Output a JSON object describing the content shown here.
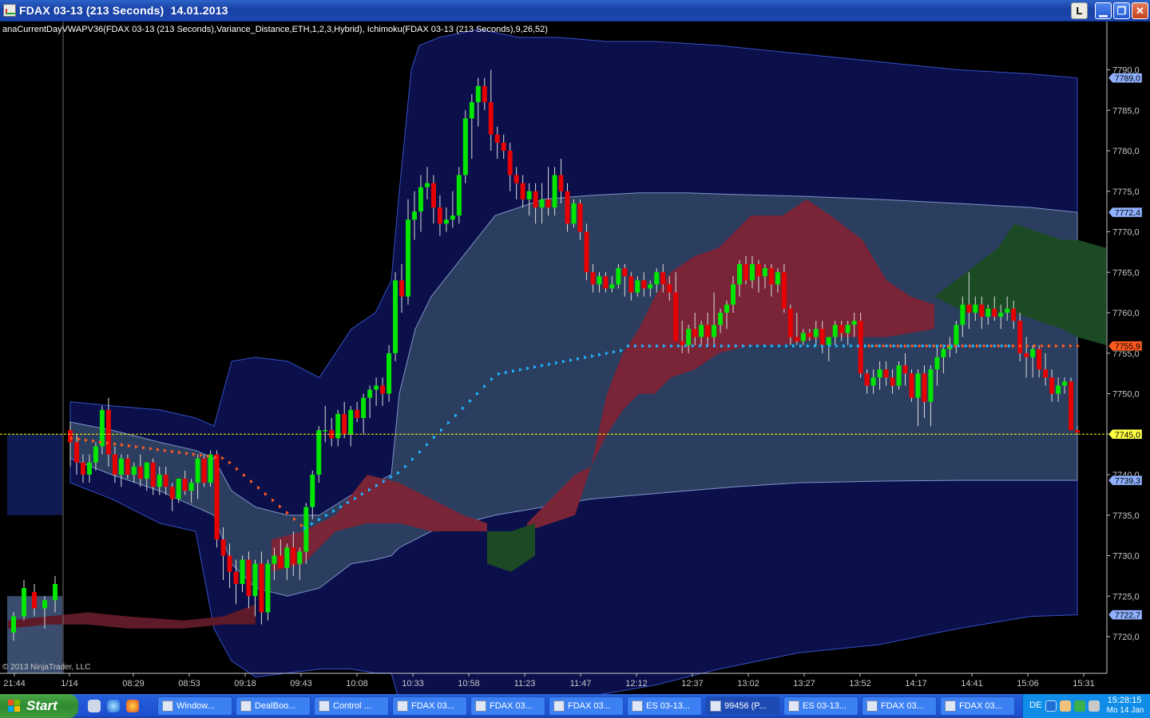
{
  "window": {
    "title": "FDAX 03-13 (213 Seconds)  14.01.2013",
    "btn_l": "L"
  },
  "chart": {
    "indicator_label": "anaCurrentDayVWAPV36(FDAX 03-13 (213 Seconds),Variance_Distance,ETH,1,2,3,Hybrid),  Ichimoku(FDAX 03-13 (213 Seconds),9,26,52)",
    "copyright": "© 2013 NinjaTrader, LLC",
    "colors": {
      "up": "#00e600",
      "down": "#e60000",
      "vwap_band": "#2c3e5f",
      "outer_band": "#0b0f4a",
      "kumo_red": "#7a2438",
      "kumo_green": "#1b4a25",
      "tenkan": "#ff5a1e",
      "kijun": "#1eb4ff",
      "current_line": "#ffff00"
    }
  },
  "chart_data": {
    "type": "candlestick",
    "title": "FDAX 03-13 (213 Seconds)",
    "ylim": [
      7715,
      7795
    ],
    "y_ticks": [
      "7720,0",
      "7725,0",
      "7730,0",
      "7735,0",
      "7740,0",
      "7745,0",
      "7750,0",
      "7755,0",
      "7760,0",
      "7765,0",
      "7770,0",
      "7775,0",
      "7780,0",
      "7785,0",
      "7790,0"
    ],
    "x_ticks": [
      "21:44",
      "1/14",
      "08:29",
      "08:53",
      "09:18",
      "09:43",
      "10:08",
      "10:33",
      "10:58",
      "11:23",
      "11:47",
      "12:12",
      "12:37",
      "13:02",
      "13:27",
      "13:52",
      "14:17",
      "14:41",
      "15:06",
      "15:31"
    ],
    "price_markers": [
      {
        "label": "7789,0",
        "value": 7789.0,
        "color": "#8fb1ff"
      },
      {
        "label": "7772,4",
        "value": 7772.4,
        "color": "#8fb1ff"
      },
      {
        "label": "7755,9",
        "value": 7755.9,
        "color": "#ff5a1e"
      },
      {
        "label": "7745,0",
        "value": 7745.0,
        "color": "#ffff44"
      },
      {
        "label": "7739,3",
        "value": 7739.3,
        "color": "#8fb1ff"
      },
      {
        "label": "7722,7",
        "value": 7722.7,
        "color": "#8fb1ff"
      }
    ],
    "current_price": 7745.0,
    "candles": [
      [
        7720.5,
        7723,
        7719.5,
        7722.5
      ],
      [
        7722.5,
        7727,
        7722,
        7726
      ],
      [
        7725.5,
        7726.5,
        7722.5,
        7723.5
      ],
      [
        7723.5,
        7725,
        7721,
        7724.5
      ],
      [
        7724.5,
        7727.5,
        7723,
        7726.5
      ],
      [
        7745.5,
        7746.5,
        7741,
        7744
      ],
      [
        7744,
        7745,
        7740,
        7741.5
      ],
      [
        7741.5,
        7742.5,
        7739,
        7740
      ],
      [
        7740,
        7742.5,
        7739,
        7741.5
      ],
      [
        7741.5,
        7744,
        7740.5,
        7743.5
      ],
      [
        7743.5,
        7748.5,
        7742.5,
        7748
      ],
      [
        7748,
        7749.5,
        7741,
        7742.5
      ],
      [
        7742.5,
        7743.5,
        7739,
        7740
      ],
      [
        7740,
        7742.5,
        7738.5,
        7742
      ],
      [
        7742,
        7742.5,
        7739.5,
        7740
      ],
      [
        7740,
        7741.5,
        7739,
        7741
      ],
      [
        7741,
        7742.5,
        7738.5,
        7739.5
      ],
      [
        7739.5,
        7741.5,
        7738,
        7741.5
      ],
      [
        7741.5,
        7742,
        7737.5,
        7738.5
      ],
      [
        7738.5,
        7741,
        7737.5,
        7740
      ],
      [
        7740,
        7741,
        7737.5,
        7738.5
      ],
      [
        7738.5,
        7739,
        7735.5,
        7737
      ],
      [
        7737,
        7739.5,
        7736.5,
        7739.5
      ],
      [
        7739.5,
        7740.5,
        7737.5,
        7738
      ],
      [
        7738,
        7739.5,
        7736.5,
        7739
      ],
      [
        7739,
        7742.5,
        7737,
        7742
      ],
      [
        7742,
        7742.5,
        7738.5,
        7739
      ],
      [
        7739,
        7743,
        7738.5,
        7742.5
      ],
      [
        7742.5,
        7743,
        7731,
        7732
      ],
      [
        7732,
        7733.5,
        7727,
        7730
      ],
      [
        7730,
        7731.5,
        7726,
        7728
      ],
      [
        7728,
        7729.5,
        7724,
        7726.5
      ],
      [
        7726.5,
        7730,
        7725.5,
        7729.5
      ],
      [
        7729.5,
        7730.5,
        7723.5,
        7725
      ],
      [
        7725,
        7729.5,
        7722.5,
        7729
      ],
      [
        7729,
        7730.5,
        7721.5,
        7723
      ],
      [
        7723,
        7729.5,
        7722,
        7729
      ],
      [
        7729,
        7731,
        7727,
        7730
      ],
      [
        7730,
        7732,
        7728.5,
        7728.5
      ],
      [
        7728.5,
        7731.5,
        7727,
        7731
      ],
      [
        7731,
        7733,
        7727.5,
        7729
      ],
      [
        7729,
        7731,
        7727,
        7730.5
      ],
      [
        7730.5,
        7736.5,
        7729,
        7736
      ],
      [
        7736,
        7740.5,
        7734.5,
        7740
      ],
      [
        7740,
        7746,
        7739,
        7745.5
      ],
      [
        7745.5,
        7748.5,
        7744,
        7745.5
      ],
      [
        7745.5,
        7747,
        7743.5,
        7744.5
      ],
      [
        7744.5,
        7748,
        7743.5,
        7747.5
      ],
      [
        7747.5,
        7749,
        7744.5,
        7745
      ],
      [
        7745,
        7748.5,
        7743.5,
        7748
      ],
      [
        7748,
        7749,
        7746.5,
        7747
      ],
      [
        7747,
        7750,
        7745,
        7749.5
      ],
      [
        7749.5,
        7751,
        7747,
        7750.5
      ],
      [
        7750.5,
        7752,
        7748.5,
        7751
      ],
      [
        7751,
        7752,
        7748.5,
        7750
      ],
      [
        7750,
        7756,
        7749,
        7755
      ],
      [
        7755,
        7765,
        7754,
        7764
      ],
      [
        7764,
        7766,
        7760,
        7762
      ],
      [
        7762,
        7774,
        7761,
        7771.5
      ],
      [
        7771.5,
        7775,
        7769,
        7772.5
      ],
      [
        7772.5,
        7777,
        7770,
        7775.5
      ],
      [
        7775.5,
        7778,
        7774,
        7776
      ],
      [
        7776,
        7777,
        7771,
        7773
      ],
      [
        7773,
        7774.5,
        7769.5,
        7771
      ],
      [
        7771,
        7773,
        7770,
        7771.5
      ],
      [
        7771.5,
        7775,
        7770.5,
        7772
      ],
      [
        7772,
        7778,
        7771,
        7777
      ],
      [
        7777,
        7785,
        7776,
        7784
      ],
      [
        7784,
        7787,
        7779,
        7786
      ],
      [
        7786,
        7789,
        7783,
        7788
      ],
      [
        7788,
        7789,
        7785,
        7786
      ],
      [
        7786,
        7790,
        7780,
        7782
      ],
      [
        7782,
        7783,
        7779,
        7781
      ],
      [
        7781,
        7782,
        7779,
        7780
      ],
      [
        7780,
        7781,
        7775,
        7777
      ],
      [
        7777,
        7778,
        7774,
        7776
      ],
      [
        7776,
        7777,
        7773,
        7774
      ],
      [
        7774,
        7776,
        7772,
        7775
      ],
      [
        7775,
        7776,
        7771,
        7773
      ],
      [
        7773,
        7776,
        7771,
        7774
      ],
      [
        7774,
        7778,
        7772,
        7773
      ],
      [
        7773,
        7778,
        7772,
        7777
      ],
      [
        7777,
        7779,
        7773.5,
        7775
      ],
      [
        7775,
        7776,
        7770,
        7771
      ],
      [
        7771,
        7774,
        7770.5,
        7773.5
      ],
      [
        7773.5,
        7774,
        7769,
        7770
      ],
      [
        7770,
        7771,
        7764,
        7765
      ],
      [
        7765,
        7766,
        7762.5,
        7763.5
      ],
      [
        7763.5,
        7765,
        7762.5,
        7764.5
      ],
      [
        7764.5,
        7765,
        7762.5,
        7763
      ],
      [
        7763,
        7764.5,
        7762.5,
        7763.5
      ],
      [
        7763.5,
        7766,
        7763,
        7765.5
      ],
      [
        7765.5,
        7766,
        7762,
        7764.5
      ],
      [
        7764.5,
        7765,
        7761.5,
        7762.5
      ],
      [
        7762.5,
        7764.5,
        7762,
        7764
      ],
      [
        7764,
        7765,
        7762,
        7763
      ],
      [
        7763,
        7764,
        7762,
        7763.5
      ],
      [
        7763.5,
        7765.5,
        7762.5,
        7765
      ],
      [
        7765,
        7766,
        7762.5,
        7763.5
      ],
      [
        7763.5,
        7764.5,
        7761.5,
        7762.5
      ],
      [
        7762.5,
        7765,
        7760.5,
        7756.5
      ],
      [
        7756.5,
        7759,
        7755,
        7756
      ],
      [
        7756,
        7758.5,
        7755,
        7758
      ],
      [
        7758,
        7760,
        7756,
        7757
      ],
      [
        7757,
        7759,
        7756,
        7758.5
      ],
      [
        7758.5,
        7760,
        7756,
        7757
      ],
      [
        7757,
        7762.5,
        7756,
        7758.5
      ],
      [
        7758.5,
        7760.5,
        7757.5,
        7760
      ],
      [
        7760,
        7761.5,
        7758,
        7761
      ],
      [
        7761,
        7764.5,
        7760,
        7763.5
      ],
      [
        7763.5,
        7766.5,
        7762,
        7766
      ],
      [
        7766,
        7767,
        7763.5,
        7764
      ],
      [
        7764,
        7767,
        7763,
        7766
      ],
      [
        7766,
        7766.5,
        7762.5,
        7764.5
      ],
      [
        7764.5,
        7766,
        7763,
        7765.5
      ],
      [
        7765.5,
        7766,
        7762,
        7763.5
      ],
      [
        7763.5,
        7765.5,
        7762.5,
        7765
      ],
      [
        7765,
        7766,
        7760,
        7760.5
      ],
      [
        7760.5,
        7761,
        7756,
        7757
      ],
      [
        7757,
        7760,
        7756,
        7756.5
      ],
      [
        7756.5,
        7758,
        7756,
        7757.5
      ],
      [
        7757.5,
        7758,
        7756.5,
        7757
      ],
      [
        7757,
        7759,
        7756,
        7758
      ],
      [
        7758,
        7759,
        7755,
        7756
      ],
      [
        7756,
        7757,
        7754,
        7757
      ],
      [
        7757,
        7759,
        7756,
        7758.5
      ],
      [
        7758.5,
        7759,
        7756.5,
        7757.5
      ],
      [
        7757.5,
        7759,
        7756,
        7758.5
      ],
      [
        7758.5,
        7760,
        7757,
        7759
      ],
      [
        7759,
        7760,
        7752,
        7752.5
      ],
      [
        7752.5,
        7753,
        7750,
        7751
      ],
      [
        7751,
        7753,
        7750,
        7752
      ],
      [
        7752,
        7754,
        7750.5,
        7753
      ],
      [
        7753,
        7754,
        7751,
        7752
      ],
      [
        7752,
        7753,
        7750,
        7751
      ],
      [
        7751,
        7754,
        7750.5,
        7753.5
      ],
      [
        7753.5,
        7755,
        7751,
        7752.5
      ],
      [
        7752.5,
        7753,
        7749,
        7749.5
      ],
      [
        7749.5,
        7753,
        7746,
        7752.5
      ],
      [
        7752.5,
        7753.5,
        7747,
        7749
      ],
      [
        7749,
        7753.5,
        7746,
        7753
      ],
      [
        7753,
        7756,
        7751,
        7754.5
      ],
      [
        7754.5,
        7756,
        7752.5,
        7755.5
      ],
      [
        7755.5,
        7757,
        7754.5,
        7756
      ],
      [
        7756,
        7759,
        7755,
        7758.5
      ],
      [
        7758.5,
        7762,
        7757,
        7761
      ],
      [
        7761,
        7765,
        7758,
        7760
      ],
      [
        7760,
        7762,
        7759,
        7761
      ],
      [
        7761,
        7762,
        7758,
        7759.5
      ],
      [
        7759.5,
        7761,
        7758.5,
        7760.5
      ],
      [
        7760.5,
        7762,
        7759,
        7759.5
      ],
      [
        7759.5,
        7761,
        7758,
        7760
      ],
      [
        7760,
        7762,
        7759,
        7760.5
      ],
      [
        7760.5,
        7761.5,
        7758,
        7759
      ],
      [
        7759,
        7760,
        7754,
        7755
      ],
      [
        7755,
        7757,
        7752,
        7754.5
      ],
      [
        7754.5,
        7756,
        7752,
        7755.5
      ],
      [
        7755.5,
        7756,
        7752,
        7753
      ],
      [
        7753,
        7755,
        7751,
        7752
      ],
      [
        7752,
        7753,
        7749,
        7750
      ],
      [
        7750,
        7752,
        7749,
        7751
      ],
      [
        7751,
        7752,
        7750,
        7751.5
      ],
      [
        7751.5,
        7752,
        7745.5,
        7745.5
      ],
      [
        7745.5,
        7746,
        7745,
        7745.2
      ]
    ]
  },
  "taskbar": {
    "start_label": "Start",
    "tasks": [
      {
        "label": "Window...",
        "active": false
      },
      {
        "label": "DealBoo...",
        "active": false
      },
      {
        "label": "Control ...",
        "active": false
      },
      {
        "label": "FDAX 03...",
        "active": false
      },
      {
        "label": "FDAX 03...",
        "active": false
      },
      {
        "label": "FDAX 03...",
        "active": false
      },
      {
        "label": "ES 03-13...",
        "active": false
      },
      {
        "label": "99456 (P...",
        "active": true
      },
      {
        "label": "ES 03-13...",
        "active": false
      },
      {
        "label": "FDAX 03...",
        "active": false
      },
      {
        "label": "FDAX 03...",
        "active": false
      }
    ],
    "tray": {
      "lang": "DE",
      "time": "15:28:15",
      "date": "Mo 14 Jan"
    }
  }
}
